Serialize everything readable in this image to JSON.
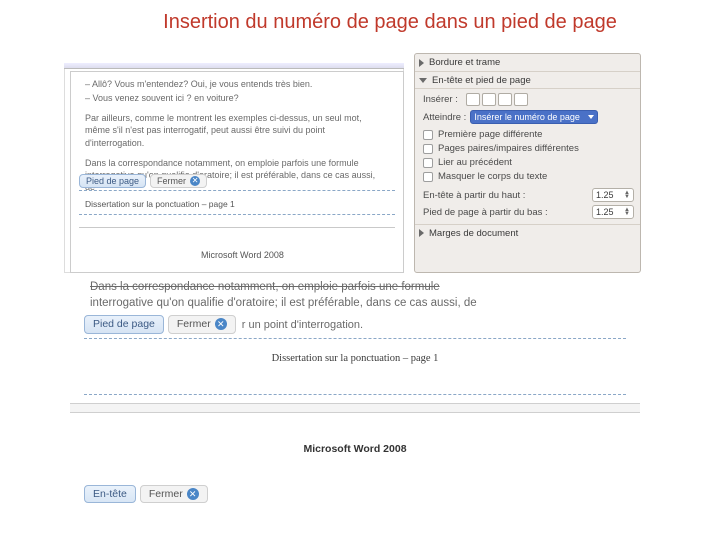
{
  "title": "Insertion du numéro de page dans un pied de page",
  "topDoc": {
    "line1": "– Allô? Vous m'entendez? Oui, je vous entends très bien.",
    "line2": "– Vous venez souvent ici ? en voiture?",
    "para2": "Par ailleurs, comme le montrent les exemples ci-dessus, un seul mot, même s'il n'est pas interrogatif, peut aussi être suivi du point d'interrogation.",
    "para3": "Dans la correspondance notamment, on emploie parfois une formule interrogative qu'on qualifie d'oratoire; il est préférable, dans ce cas aussi, de",
    "footerLabel": "Pied de page",
    "closeLabel": "Fermer",
    "footerText": "Dissertation sur la ponctuation – page 1",
    "brand": "Microsoft Word 2008"
  },
  "palette": {
    "row_bordure": "Bordure et trame",
    "row_entete": "En-tête et pied de page",
    "insert_label": "Insérer :",
    "atteindre_label": "Atteindre :",
    "dropdown_selected": "Insérer le numéro de page",
    "opt_premiere": "Première page différente",
    "opt_pages_pi": "Pages paires/impaires différentes",
    "opt_precedent": "Lier au précédent",
    "opt_masquer": "Masquer le corps du texte",
    "spin_haut_label": "En-tête à partir du haut :",
    "spin_bas_label": "Pied de page à partir du bas :",
    "spin_marges": "Marges de document",
    "spin_val": "1.25"
  },
  "botDoc": {
    "struck": "Dans la correspondance notamment, on emploie parfois une formule",
    "l2": "interrogative qu'on qualifie d'oratoire; il est préférable, dans ce cas aussi, de",
    "trail": "r un point d'interrogation.",
    "footerLabel": "Pied de page",
    "closeLabel": "Fermer",
    "center": "Dissertation sur la ponctuation – page 1",
    "brand": "Microsoft Word 2008",
    "enteteLabel": "En-tête",
    "closeLabel2": "Fermer"
  }
}
